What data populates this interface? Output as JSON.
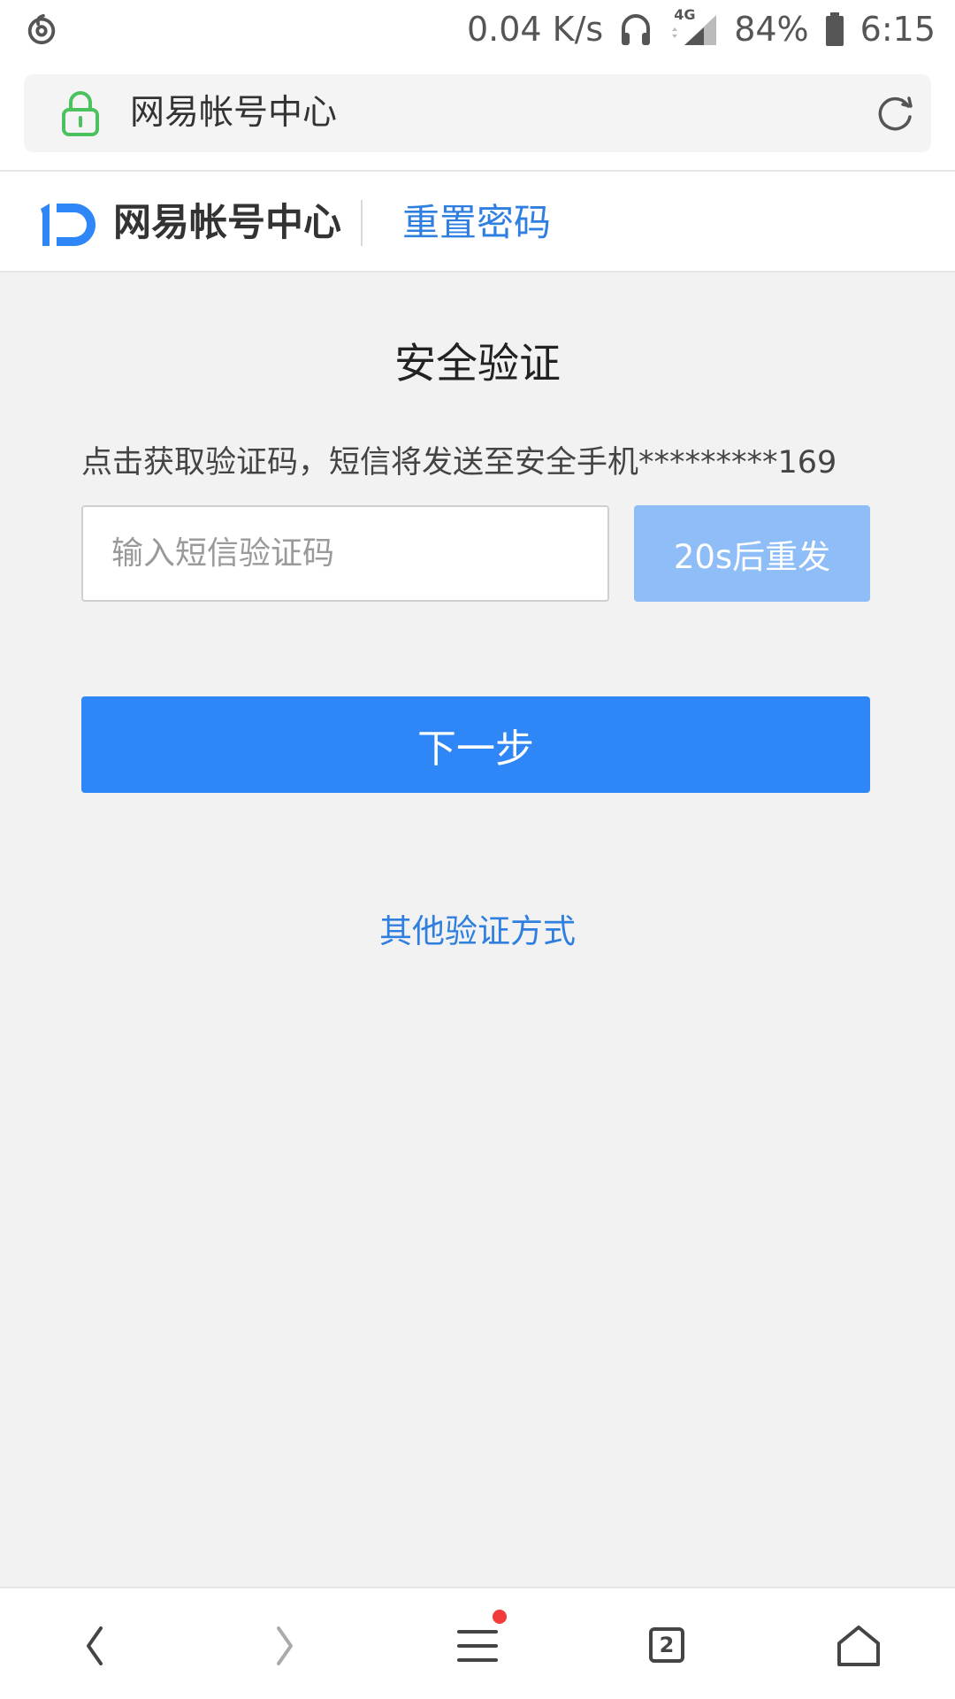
{
  "status_bar": {
    "net_speed": "0.04 K/s",
    "network_type": "4G",
    "battery": "84%",
    "time": "6:15",
    "icons": [
      "netease-music-icon",
      "headset-icon",
      "signal-icon",
      "battery-icon"
    ]
  },
  "address_bar": {
    "title": "网易帐号中心",
    "icons": [
      "lock-icon",
      "reload-icon"
    ]
  },
  "header": {
    "logo_text": "网易帐号中心",
    "subtitle": "重置密码"
  },
  "main": {
    "title": "安全验证",
    "hint": "点击获取验证码，短信将发送至安全手机*********169",
    "code_input": {
      "placeholder": "输入短信验证码",
      "value": ""
    },
    "resend_label": "20s后重发",
    "next_label": "下一步",
    "other_methods_label": "其他验证方式"
  },
  "bottom_nav": {
    "tab_count": "2",
    "items": [
      "back",
      "forward",
      "menu",
      "tabs",
      "home"
    ]
  },
  "colors": {
    "accent": "#2f86f6",
    "accent_light": "#8fbdf7",
    "link": "#2f7fe0",
    "background": "#f2f2f2",
    "lock_green": "#4cc25e",
    "badge_red": "#f23c3c"
  }
}
